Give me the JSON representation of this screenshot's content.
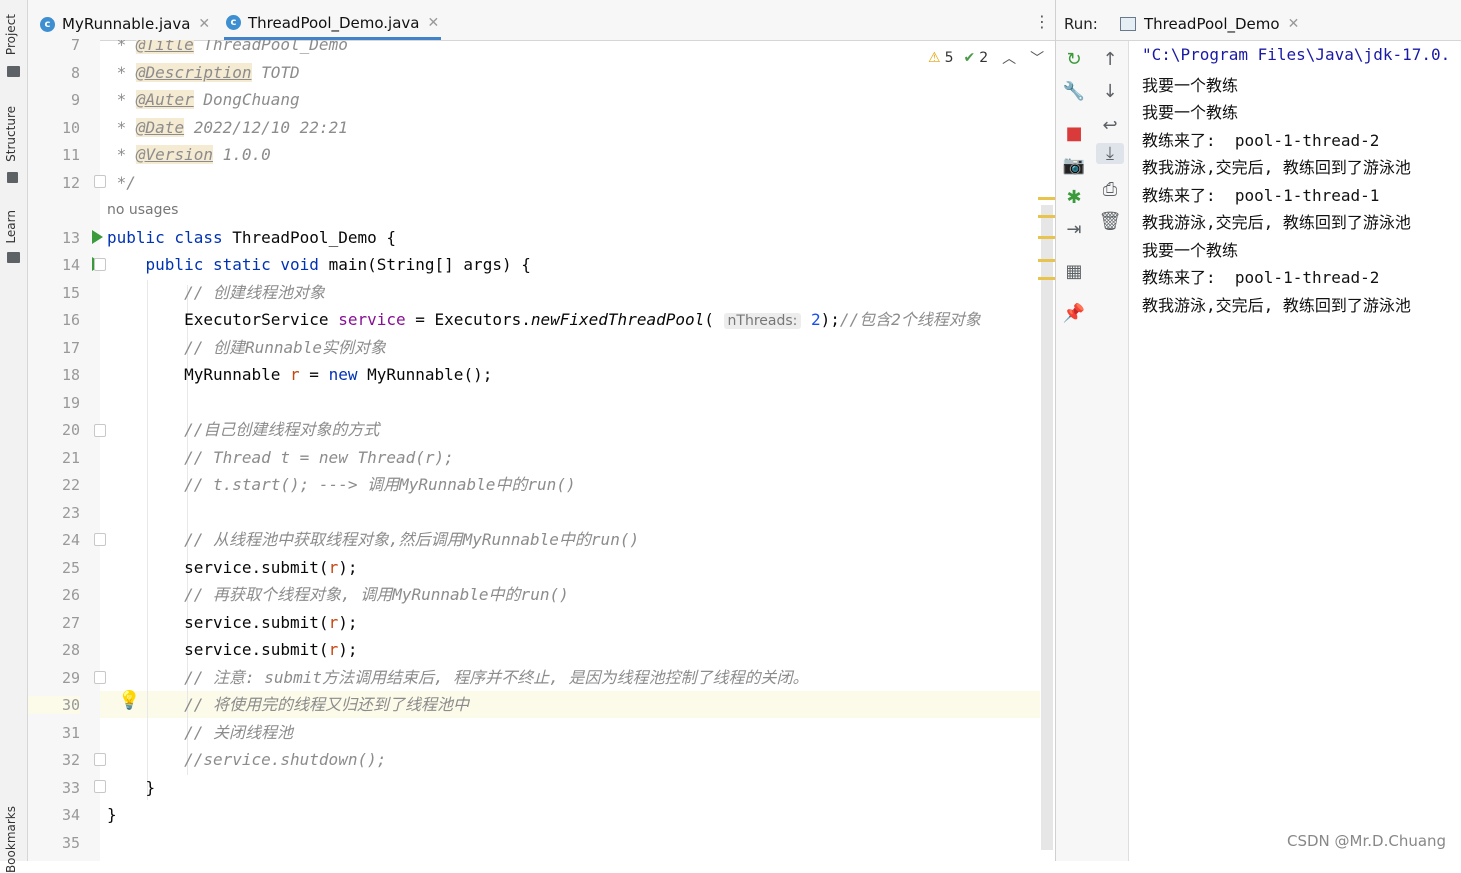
{
  "left_strip": {
    "project": "Project",
    "structure": "Structure",
    "learn": "Learn",
    "bookmarks": "Bookmarks"
  },
  "editor_tabs": [
    {
      "label": "MyRunnable.java",
      "active": false
    },
    {
      "label": "ThreadPool_Demo.java",
      "active": true
    }
  ],
  "inspection": {
    "warnings": "5",
    "weak_warnings": "2"
  },
  "code": {
    "l7_tag": "@Title",
    "l7_text": " ThreadPool_Demo",
    "l8_tag": "@Description",
    "l8_text": " TOTD",
    "l9_tag": "@Auter",
    "l9_text": " DongChuang",
    "l10_tag": "@Date",
    "l10_text": " 2022/12/10 22:21",
    "l11_tag": "@Version",
    "l11_text": " 1.0.0",
    "l12": " */",
    "no_usages": "no usages",
    "l13_kw": "public class ",
    "l13_text": "ThreadPool_Demo {",
    "l14_kw": "public static void ",
    "l14_text": "main(String[] args) {",
    "l15": "// 创建线程池对象",
    "l16_a": "ExecutorService ",
    "l16_var": "service",
    "l16_b": " = Executors.",
    "l16_m": "newFixedThreadPool",
    "l16_c": "( ",
    "l16_hint": "nThreads:",
    "l16_num": " 2",
    "l16_d": ");",
    "l16_cm": "//包含2个线程对象",
    "l17": "// 创建Runnable实例对象",
    "l18_a": "MyRunnable ",
    "l18_var": "r",
    "l18_b": " = ",
    "l18_kw": "new ",
    "l18_c": "MyRunnable();",
    "l20": "//自己创建线程对象的方式",
    "l21": "// Thread t = new Thread(r);",
    "l22": "// t.start(); ---> 调用MyRunnable中的run()",
    "l24": "// 从线程池中获取线程对象,然后调用MyRunnable中的run()",
    "l25_a": "service.submit(",
    "l25_var": "r",
    "l25_b": ");",
    "l26": "// 再获取个线程对象, 调用MyRunnable中的run()",
    "l27_a": "service.submit(",
    "l27_var": "r",
    "l27_b": ");",
    "l28_a": "service.submit(",
    "l28_var": "r",
    "l28_b": ");",
    "l29": "// 注意: submit方法调用结束后, 程序并不终止, 是因为线程池控制了线程的关闭。",
    "l30": "// 将使用完的线程又归还到了线程池中",
    "l31": "// 关闭线程池",
    "l32": "//service.shutdown();",
    "l33": "}",
    "l34": "}"
  },
  "line_numbers": [
    "7",
    "8",
    "9",
    "10",
    "11",
    "12",
    "13",
    "14",
    "15",
    "16",
    "17",
    "18",
    "19",
    "20",
    "21",
    "22",
    "23",
    "24",
    "25",
    "26",
    "27",
    "28",
    "29",
    "30",
    "31",
    "32",
    "33",
    "34",
    "35"
  ],
  "run": {
    "label": "Run:",
    "tab": "ThreadPool_Demo",
    "output": [
      "\"C:\\Program Files\\Java\\jdk-17.0.",
      "我要一个教练",
      "我要一个教练",
      "教练来了:  pool-1-thread-2",
      "教我游泳,交完后, 教练回到了游泳池",
      "教练来了:  pool-1-thread-1",
      "教我游泳,交完后, 教练回到了游泳池",
      "我要一个教练",
      "教练来了:  pool-1-thread-2",
      "教我游泳,交完后, 教练回到了游泳池"
    ]
  },
  "watermark": "CSDN @Mr.D.Chuang"
}
